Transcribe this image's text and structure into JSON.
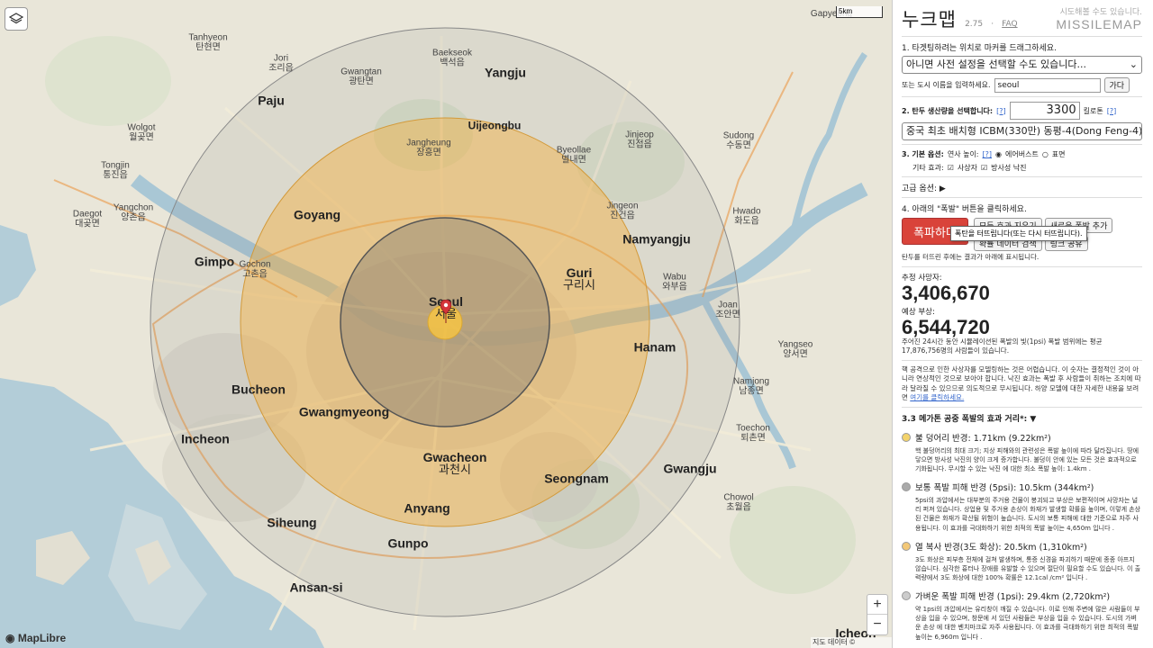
{
  "map": {
    "attribution": "지도 데이터 © OpenStreetMap",
    "maplibre": "MapLibre",
    "scale_label": "5km",
    "places": {
      "seoul": {
        "en": "Seoul",
        "ko": "서울"
      },
      "uijeongbu": {
        "en": "Uijeongbu"
      },
      "yangju": {
        "en": "Yangju"
      },
      "paju": {
        "en": "Paju"
      },
      "goyang": {
        "en": "Goyang"
      },
      "gimpo": {
        "en": "Gimpo"
      },
      "namyangju": {
        "en": "Namyangju"
      },
      "guri": {
        "en": "Guri",
        "ko": "구리시"
      },
      "hanam": {
        "en": "Hanam"
      },
      "bucheon": {
        "en": "Bucheon"
      },
      "gwangmyeong": {
        "en": "Gwangmyeong"
      },
      "incheon": {
        "en": "Incheon"
      },
      "gwacheon": {
        "en": "Gwacheon",
        "ko": "과천시"
      },
      "seongnam": {
        "en": "Seongnam"
      },
      "gwangju": {
        "en": "Gwangju"
      },
      "anyang": {
        "en": "Anyang"
      },
      "siheung": {
        "en": "Siheung"
      },
      "gunpo": {
        "en": "Gunpo"
      },
      "ansan": {
        "en": "Ansan-si"
      },
      "icheon": {
        "en": "Icheon"
      },
      "baekseok": {
        "en": "Baekseok",
        "ko": "백석읍"
      },
      "gwangtan": {
        "en": "Gwangtan",
        "ko": "광탄면"
      },
      "jangheung": {
        "en": "Jangheung",
        "ko": "장흥면"
      },
      "byeollae": {
        "en": "Byeollae",
        "ko": "별내면"
      },
      "jinjeop": {
        "en": "Jinjeop",
        "ko": "진접읍"
      },
      "jingeon": {
        "en": "Jingeon",
        "ko": "진건읍"
      },
      "wabu": {
        "en": "Wabu",
        "ko": "와부읍"
      },
      "yangseo": {
        "en": "Yangseo",
        "ko": "양서면"
      },
      "chowol": {
        "en": "Chowol",
        "ko": "초월읍"
      },
      "toechon": {
        "en": "Toechon",
        "ko": "퇴촌면"
      },
      "sudong": {
        "en": "Sudong",
        "ko": "수동면"
      },
      "hwado": {
        "en": "Hwado",
        "ko": "화도읍"
      },
      "joan": {
        "en": "Joan",
        "ko": "조안면"
      },
      "namjong": {
        "en": "Namjong",
        "ko": "남종면"
      },
      "gapyeong": {
        "en": "Gapyeong"
      },
      "tongjin": {
        "en": "Tongjin",
        "ko": "통진읍"
      },
      "yangchon": {
        "en": "Yangchon",
        "ko": "양촌읍"
      },
      "daegot": {
        "en": "Daegot",
        "ko": "대곶면"
      },
      "gochon": {
        "en": "Gochon",
        "ko": "고촌읍"
      },
      "wolgot": {
        "en": "Wolgot",
        "ko": "월곶면"
      },
      "jori": {
        "en": "Jori",
        "ko": "조리읍"
      },
      "tanhyeon": {
        "en": "Tanhyeon",
        "ko": "탄현면"
      }
    }
  },
  "sidebar": {
    "title": "누크맵",
    "version": "2.75",
    "faq": "FAQ",
    "tagline": "시도해볼 수도 있습니다.",
    "brand": "MISSILEMAP",
    "step1": {
      "label": "1. 타겟팅하려는 위치로 마커를 드래그하세요.",
      "preset_placeholder": "아니면 사전 설정을 선택할 수도 있습니다...",
      "city_label": "또는 도시 이름을 입력하세요.",
      "city_value": "seoul",
      "go": "가다"
    },
    "step2": {
      "label": "2. 탄두 생산량을 선택합니다:",
      "help": "[?]",
      "yield_value": "3300",
      "unit": "킬로톤",
      "unit_help": "[?]",
      "weapon": "중국 최초 배치형 ICBM(330만) 동평-4(Dong Feng-4)"
    },
    "step3": {
      "label": "3. 기본 옵션:",
      "height_label": "연사 높이:",
      "height_help": "[?]",
      "airburst": "에어버스트",
      "surface": "표면",
      "other_label": "기타 효과:",
      "casualties": "사상자",
      "fallout": "방사성 낙진"
    },
    "advanced": "고급 옵션:",
    "step4": {
      "label": "4. 아래의 \"폭발\" 버튼을 클릭하세요.",
      "detonate": "폭파하다",
      "clear": "모든 효과 지우기",
      "add": "새로운 폭발 추가",
      "probe": "확률 데이터 검색",
      "link": "링크 공유",
      "tooltip": "폭탄을 터뜨립니다(또는 다시 터뜨립니다).",
      "note": "탄두를 터뜨린 후에는 결과가 아래에 표시됩니다."
    },
    "results": {
      "deaths_label": "추정 사망자:",
      "deaths": "3,406,670",
      "injuries_label": "예상 부상:",
      "injuries": "6,544,720",
      "range_note": "주어진 24시간 동안 시뮬레이션된 폭발의 빛(1psi) 폭발 범위에는 평균 17,876,756명의 사람들이 있습니다.",
      "disclaimer": "핵 공격으로 인한 사상자를 모델링하는 것은 어렵습니다. 이 숫자는 결정적인 것이 아니라 연상적인 것으로 보아야 합니다. 낙진 효과는 폭발 후 사람들이 취하는 조치에 따라 달라질 수 있으므로 의도적으로 무시됩니다. 하양 모델에 대한 자세한 내용을 보려면",
      "disclaimer_link": "여기를 클릭하세요."
    },
    "effects_header": "3.3 메가톤 공중 폭발의 효과 거리*: ▼",
    "effects": [
      {
        "color": "#f3d36b",
        "title": "불 덩어리 반경: 1.71km (9.22km²)",
        "desc": "핵 불덩어리의 최대 크기; 지상 피해와의 관련성은 폭발 높이에 따라 달라집니다. 땅에 닿으면 방사성 낙진의 양이 크게 증가합니다. 불덩이 안에 있는 모든 것은 효과적으로 기화됩니다. 무시할 수 있는 낙진 에 대한 최소 폭발 높이: 1.4km ."
      },
      {
        "color": "#aaaaaa",
        "title": "보통 폭발 피해 반경 (5psi): 10.5km (344km²)",
        "desc": "5psi의 과압에서는 대부분의 주거용 건물이 붕괴되고 부상은 보편적이며 사망자는 널리 퍼져 있습니다. 상업용 및 주거용 손상이 화재가 발생할 확률을 높이며, 이렇게 손상된 건물은 화재가 확산될 위험이 높습니다. 도시의 보통 피해에 대한 기준으로 자주 사용됩니다. 이 효과를 극대화하기 위한 최적의 폭발 높이는 4,650m 입니다 ."
      },
      {
        "color": "#f3c877",
        "title": "열 복사 반경(3도 화상): 20.5km (1,310km²)",
        "desc": "3도 화상은 피부층 전체에 걸쳐 발생하며, 통증 신경을 파괴하기 때문에 종종 아프지 않습니다. 심각한 흉터나 장애를 유발할 수 있으며 절단이 필요할 수도 있습니다. 이 출력량에서 3도 화상에 대한 100% 확률은 12.1cal /cm² 입니다 ."
      },
      {
        "color": "#cccccc",
        "title": "가벼운 폭발 피해 반경 (1psi): 29.4km (2,720km²)",
        "desc": "약 1psi의 과압에서는 유리창이 깨질 수 있습니다. 이로 인해 주변에 많은 사람들이 부상을 입을 수 있으며, 창문에 서 있던 사람들은 부상을 입을 수 있습니다. 도시의 가벼운 손상 에 대한 벤치마크로 자주 사용됩니다. 이 효과를 극대화하기 위한 최적의 폭발 높이는 6,960m 입니다 ."
      }
    ]
  }
}
